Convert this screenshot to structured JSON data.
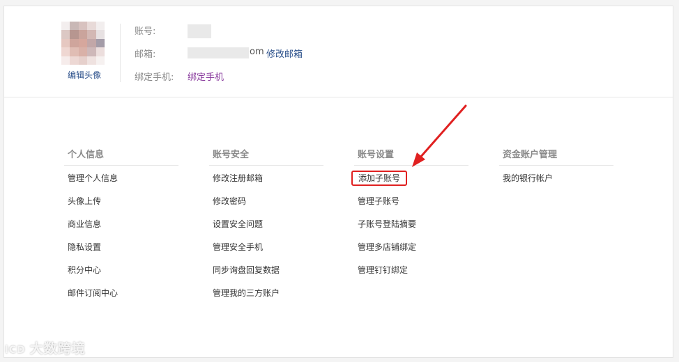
{
  "profile": {
    "account_label": "账号:",
    "email_label": "邮箱:",
    "email_suffix": "om",
    "edit_email": "修改邮箱",
    "phone_label": "绑定手机:",
    "bind_phone": "绑定手机",
    "edit_avatar": "编辑头像"
  },
  "columns": [
    {
      "title": "个人信息",
      "items": [
        "管理个人信息",
        "头像上传",
        "商业信息",
        "隐私设置",
        "积分中心",
        "邮件订阅中心"
      ]
    },
    {
      "title": "账号安全",
      "items": [
        "修改注册邮箱",
        "修改密码",
        "设置安全问题",
        "管理安全手机",
        "同步询盘回复数据",
        "管理我的三方账户"
      ]
    },
    {
      "title": "账号设置",
      "items": [
        "添加子账号",
        "管理子账号",
        "子账号登陆摘要",
        "管理多店铺绑定",
        "管理钉钉绑定"
      ]
    },
    {
      "title": "资金账户管理",
      "items": [
        "我的银行帐户"
      ]
    }
  ],
  "watermark": {
    "logo": "lCD",
    "text": "大数跨境"
  },
  "colors": {
    "link_blue": "#2a4f8a",
    "link_purple": "#8a3c9e",
    "highlight_red": "#e02020"
  }
}
